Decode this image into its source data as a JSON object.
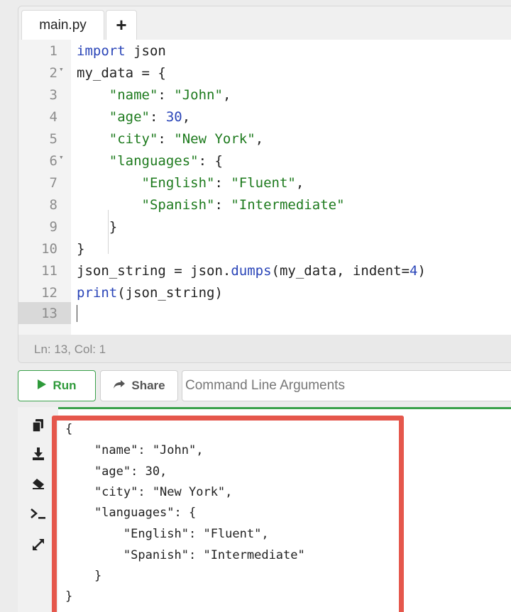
{
  "tabs": {
    "active_file": "main.py",
    "add_label": "+"
  },
  "editor": {
    "lines": [
      {
        "num": "1",
        "text": "import json"
      },
      {
        "num": "2",
        "text": "my_data = {"
      },
      {
        "num": "3",
        "text": "    \"name\": \"John\","
      },
      {
        "num": "4",
        "text": "    \"age\": 30,"
      },
      {
        "num": "5",
        "text": "    \"city\": \"New York\","
      },
      {
        "num": "6",
        "text": "    \"languages\": {"
      },
      {
        "num": "7",
        "text": "        \"English\": \"Fluent\","
      },
      {
        "num": "8",
        "text": "        \"Spanish\": \"Intermediate\""
      },
      {
        "num": "9",
        "text": "    }"
      },
      {
        "num": "10",
        "text": "}"
      },
      {
        "num": "11",
        "text": "json_string = json.dumps(my_data, indent=4)"
      },
      {
        "num": "12",
        "text": "print(json_string)"
      },
      {
        "num": "13",
        "text": ""
      }
    ],
    "fold_marker": "▾",
    "status": "Ln: 13,  Col: 1"
  },
  "toolbar": {
    "run_label": "Run",
    "share_label": "Share",
    "args_placeholder": "Command Line Arguments"
  },
  "output": {
    "lines": [
      "{",
      "    \"name\": \"John\",",
      "    \"age\": 30,",
      "    \"city\": \"New York\",",
      "    \"languages\": {",
      "        \"English\": \"Fluent\",",
      "        \"Spanish\": \"Intermediate\"",
      "    }",
      "}"
    ],
    "side_icons": [
      "copy-icon",
      "download-icon",
      "eraser-icon",
      "terminal-icon",
      "expand-icon"
    ]
  },
  "colors": {
    "run_green": "#2e9a3a",
    "highlight_red": "#e5574c",
    "keyword_blue": "#2a45b8",
    "string_green": "#1d7a1d"
  }
}
